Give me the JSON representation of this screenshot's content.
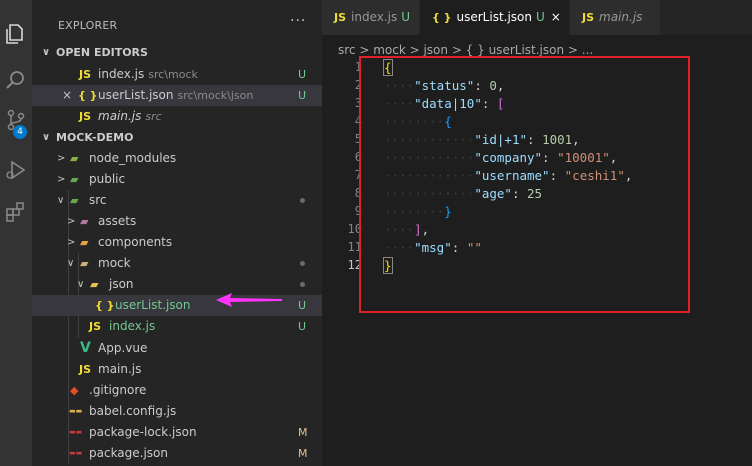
{
  "explorer": {
    "title": "EXPLORER",
    "more": "···",
    "open_editors_label": "OPEN EDITORS",
    "open_editors": [
      {
        "icon": "JS",
        "name": "index.js",
        "desc": "src\\mock",
        "status": "U",
        "italic": false
      },
      {
        "icon": "{ }",
        "name": "userList.json",
        "desc": "src\\mock\\json",
        "status": "U",
        "italic": false,
        "close": "×"
      },
      {
        "icon": "JS",
        "name": "main.js",
        "desc": "src",
        "status": "",
        "italic": true
      }
    ],
    "project_label": "MOCK-DEMO",
    "tree": [
      {
        "name": "node_modules",
        "status": ""
      },
      {
        "name": "public",
        "status": ""
      },
      {
        "name": "src",
        "status": ""
      },
      {
        "name": "assets",
        "status": ""
      },
      {
        "name": "components",
        "status": ""
      },
      {
        "name": "mock",
        "status": ""
      },
      {
        "name": "json",
        "status": ""
      },
      {
        "name": "userList.json",
        "status": "U"
      },
      {
        "name": "index.js",
        "status": "U"
      },
      {
        "name": "App.vue",
        "status": ""
      },
      {
        "name": "main.js",
        "status": ""
      },
      {
        "name": ".gitignore",
        "status": ""
      },
      {
        "name": "babel.config.js",
        "status": ""
      },
      {
        "name": "package-lock.json",
        "status": "M"
      },
      {
        "name": "package.json",
        "status": "M"
      }
    ]
  },
  "activity_bar": {
    "icons": [
      "files-icon",
      "search-icon",
      "source-control-icon",
      "run-debug-icon",
      "extensions-icon"
    ],
    "scm_badge": "4"
  },
  "tabs": [
    {
      "icon": "JS",
      "label": "index.js",
      "status": "U",
      "active": false,
      "italic": false
    },
    {
      "icon": "{ }",
      "label": "userList.json",
      "status": "U",
      "close": "×",
      "active": true,
      "italic": false
    },
    {
      "icon": "JS",
      "label": "main.js",
      "status": "",
      "active": false,
      "italic": true
    }
  ],
  "breadcrumb": "src > mock > json > { } userList.json > ...",
  "code_lines": [
    "1",
    "2",
    "3",
    "4",
    "5",
    "6",
    "7",
    "8",
    "9",
    "10",
    "11",
    "12"
  ],
  "code": {
    "status_key": "\"status\"",
    "status_val": "0",
    "data_key": "\"data|10\"",
    "id_key": "\"id|+1\"",
    "id_val": "1001",
    "company_key": "\"company\"",
    "company_val": "\"10001\"",
    "username_key": "\"username\"",
    "username_val": "\"ceshi1\"",
    "age_key": "\"age\"",
    "age_val": "25",
    "msg_key": "\"msg\"",
    "msg_val": "\"\""
  },
  "colors": {
    "accent": "#007acc",
    "annotation_box": "#e0202a",
    "annotation_arrow": "#ff33ff"
  }
}
